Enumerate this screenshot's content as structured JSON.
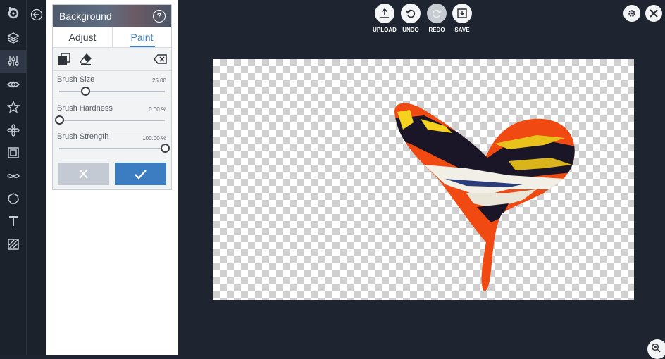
{
  "panel": {
    "title": "Background",
    "help": "?",
    "tabs": [
      "Adjust",
      "Paint"
    ],
    "active_tab": "Paint",
    "sliders": [
      {
        "label": "Brush Size",
        "value": "25.00",
        "fraction": 0.25
      },
      {
        "label": "Brush Hardness",
        "value": "0.00 %",
        "fraction": 0.0
      },
      {
        "label": "Brush Strength",
        "value": "100.00 %",
        "fraction": 1.0
      }
    ]
  },
  "toolbar": {
    "upload": "UPLOAD",
    "undo": "UNDO",
    "redo": "REDO",
    "save": "SAVE"
  },
  "rail_tools": [
    "logo",
    "layers",
    "adjust",
    "eye",
    "star",
    "flower",
    "frame",
    "mustache",
    "shape",
    "text",
    "texture"
  ],
  "active_rail_tool": "adjust",
  "colors": {
    "accent": "#3c7dc2",
    "background": "#1e2530"
  }
}
